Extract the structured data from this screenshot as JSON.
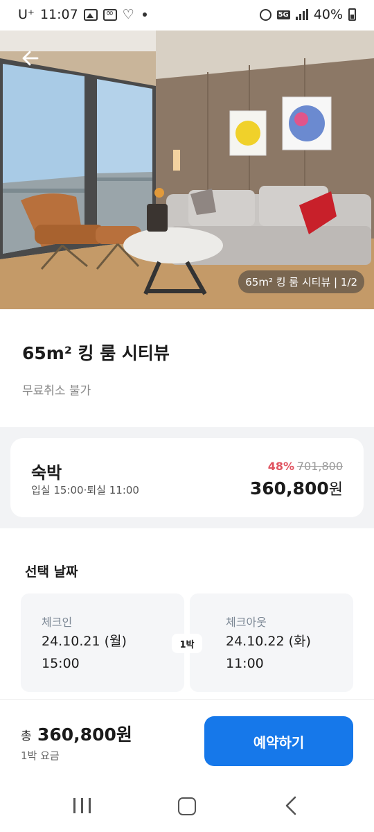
{
  "status_bar": {
    "carrier": "U⁺",
    "time": "11:07",
    "network": "5G",
    "battery": "40%"
  },
  "hero": {
    "caption": "65m² 킹 룸 시티뷰 | 1/2",
    "back_icon": "arrow-left-icon"
  },
  "room": {
    "title": "65m² 킹 룸 시티뷰",
    "policy": "무료취소 불가"
  },
  "stay_option": {
    "label": "숙박",
    "times": "입실 15:00·퇴실 11:00",
    "discount": "48%",
    "original_price": "701,800",
    "sale_price": "360,800",
    "currency": "원"
  },
  "dates": {
    "heading": "선택 날짜",
    "checkin": {
      "label": "체크인",
      "date": "24.10.21 (월)",
      "time": "15:00"
    },
    "checkout": {
      "label": "체크아웃",
      "date": "24.10.22 (화)",
      "time": "11:00"
    },
    "nights": "1박"
  },
  "booking_bar": {
    "total_label": "총",
    "total_value": "360,800원",
    "total_sub": "1박 요금",
    "button_label": "예약하기",
    "button_color": "#1678ea"
  },
  "colors": {
    "discount": "#e0525f",
    "accent": "#1678ea"
  }
}
